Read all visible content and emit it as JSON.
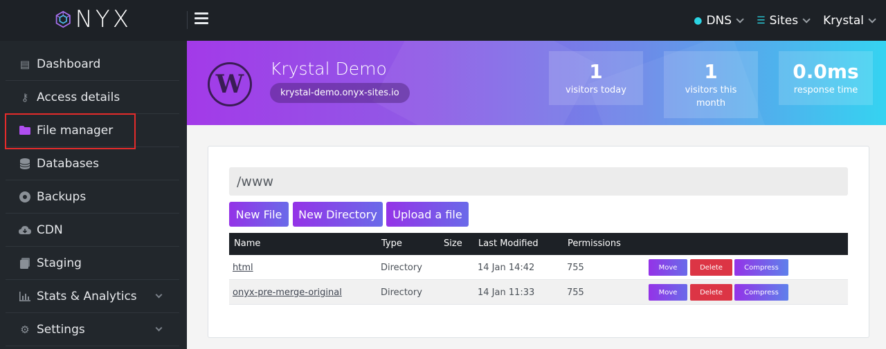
{
  "header": {
    "logo_text": "NYX",
    "nav": [
      {
        "label": "DNS",
        "icon": "globe-icon"
      },
      {
        "label": "Sites",
        "icon": "list-icon"
      },
      {
        "label": "Krystal"
      }
    ]
  },
  "sidebar": {
    "items": [
      {
        "label": "Dashboard",
        "icon": "dashboard-icon"
      },
      {
        "label": "Access details",
        "icon": "key-icon"
      },
      {
        "label": "File manager",
        "icon": "folder-icon",
        "active": true
      },
      {
        "label": "Databases",
        "icon": "database-icon"
      },
      {
        "label": "Backups",
        "icon": "backup-icon"
      },
      {
        "label": "CDN",
        "icon": "cloud-download-icon"
      },
      {
        "label": "Staging",
        "icon": "staging-icon"
      },
      {
        "label": "Stats & Analytics",
        "icon": "chart-icon",
        "expandable": true
      },
      {
        "label": "Settings",
        "icon": "gear-icon",
        "expandable": true
      }
    ]
  },
  "banner": {
    "title": "Krystal Demo",
    "url": "krystal-demo.onyx-sites.io",
    "stats": [
      {
        "value": "1",
        "label": "visitors today"
      },
      {
        "value": "1",
        "label": "visitors this month"
      },
      {
        "value": "0.0ms",
        "label": "response time"
      }
    ]
  },
  "file_manager": {
    "path": "/www",
    "buttons": [
      "New File",
      "New Directory",
      "Upload a file"
    ],
    "columns": [
      "Name",
      "Type",
      "Size",
      "Last Modified",
      "Permissions"
    ],
    "rows": [
      {
        "name": "html",
        "type": "Directory",
        "size": "",
        "modified": "14 Jan 14:42",
        "permissions": "755"
      },
      {
        "name": "onyx-pre-merge-original",
        "type": "Directory",
        "size": "",
        "modified": "14 Jan 11:33",
        "permissions": "755"
      }
    ],
    "actions": [
      "Move",
      "Delete",
      "Compress"
    ]
  },
  "colors": {
    "accent_purple": "#9433e7",
    "accent_cyan": "#35d3f1",
    "danger": "#dc3545",
    "highlight_border": "#e52b2b"
  }
}
